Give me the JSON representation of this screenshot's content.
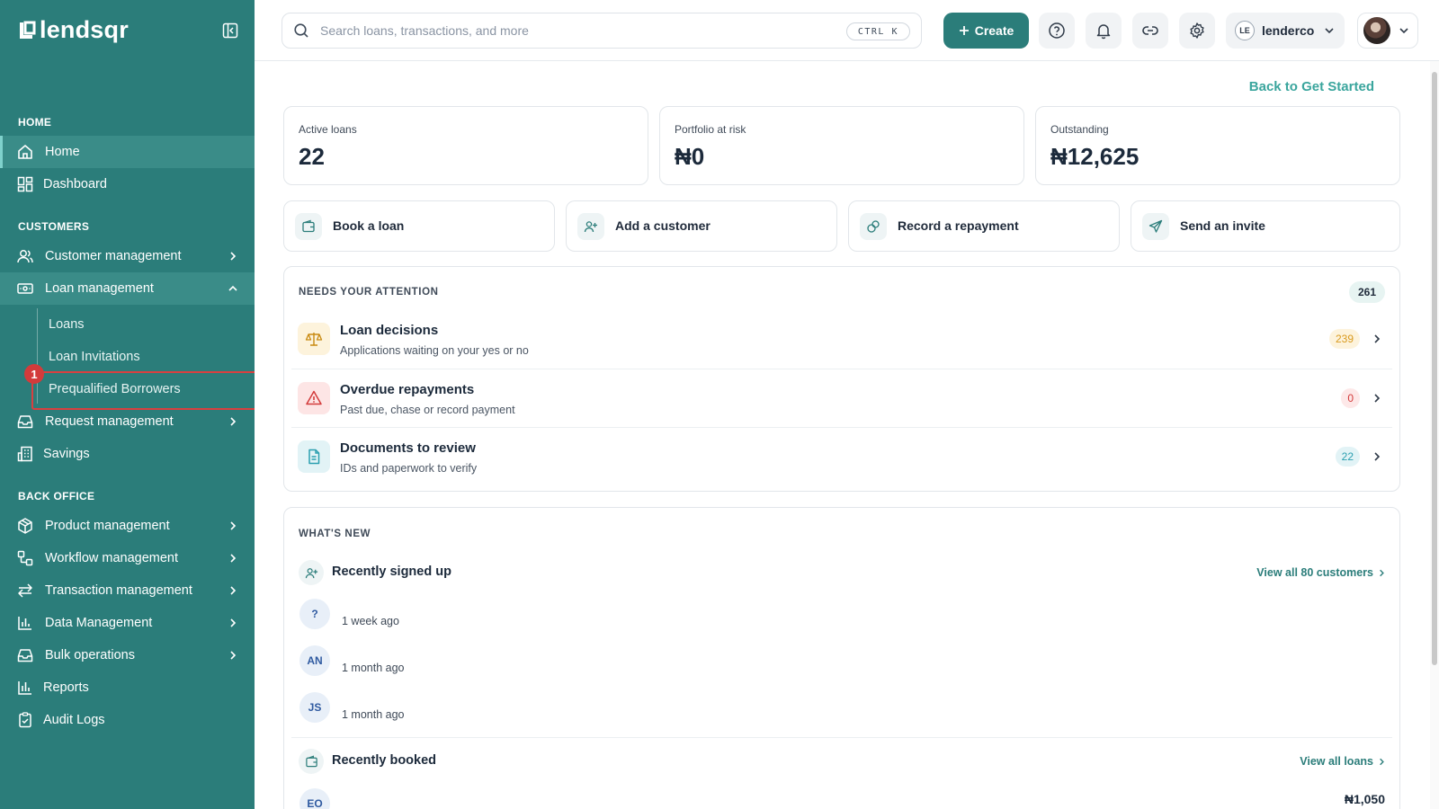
{
  "brand": {
    "name": "lendsqr"
  },
  "sidebar": {
    "sections": {
      "home": "HOME",
      "customers": "CUSTOMERS",
      "back_office": "BACK OFFICE"
    },
    "items": {
      "home": "Home",
      "dashboard": "Dashboard",
      "customer_management": "Customer management",
      "loan_management": "Loan management",
      "loans": "Loans",
      "loan_invitations": "Loan Invitations",
      "prequalified_borrowers": "Prequalified Borrowers",
      "request_management": "Request management",
      "savings": "Savings",
      "product_management": "Product management",
      "workflow_management": "Workflow management",
      "transaction_management": "Transaction management",
      "data_management": "Data Management",
      "bulk_operations": "Bulk operations",
      "reports": "Reports",
      "audit_logs": "Audit Logs"
    },
    "step_badge": "1"
  },
  "header": {
    "search_placeholder": "Search loans, transactions, and more",
    "shortcut": "CTRL K",
    "create_label": "Create",
    "account_initials": "LE",
    "account_name": "lenderco"
  },
  "main": {
    "back_link": "Back to Get Started",
    "stats": [
      {
        "title": "Active loans",
        "value": "22"
      },
      {
        "title": "Portfolio at risk",
        "value": "₦0"
      },
      {
        "title": "Outstanding",
        "value": "₦12,625"
      }
    ],
    "actions": [
      {
        "label": "Book a loan",
        "icon": "wallet-icon"
      },
      {
        "label": "Add a customer",
        "icon": "user-plus-icon"
      },
      {
        "label": "Record a repayment",
        "icon": "coins-icon"
      },
      {
        "label": "Send an invite",
        "icon": "send-icon"
      }
    ],
    "attention": {
      "title": "NEEDS YOUR ATTENTION",
      "total": "261",
      "rows": [
        {
          "title": "Loan decisions",
          "subtitle": "Applications waiting on your yes or no",
          "count": "239",
          "color": "#e0a020"
        },
        {
          "title": "Overdue repayments",
          "subtitle": "Past due, chase or record payment",
          "count": "0",
          "color": "#d33b3b"
        },
        {
          "title": "Documents to review",
          "subtitle": "IDs and paperwork to verify",
          "count": "22",
          "color": "#2b9fb0"
        }
      ]
    },
    "whats_new": {
      "title": "WHAT'S NEW",
      "signed_up": {
        "heading": "Recently signed up",
        "link": "View all 80 customers",
        "people": [
          {
            "initials": "?",
            "time": "1 week ago"
          },
          {
            "initials": "AN",
            "time": "1 month ago"
          },
          {
            "initials": "JS",
            "time": "1 month ago"
          }
        ]
      },
      "booked": {
        "heading": "Recently booked",
        "link": "View all loans",
        "first_initials": "EO",
        "first_amount": "₦1,050"
      }
    }
  },
  "colors": {
    "sidebar": "#2b7d7a",
    "accent": "#2b7d7a",
    "link": "#3aa59d",
    "highlight": "#d84040"
  }
}
